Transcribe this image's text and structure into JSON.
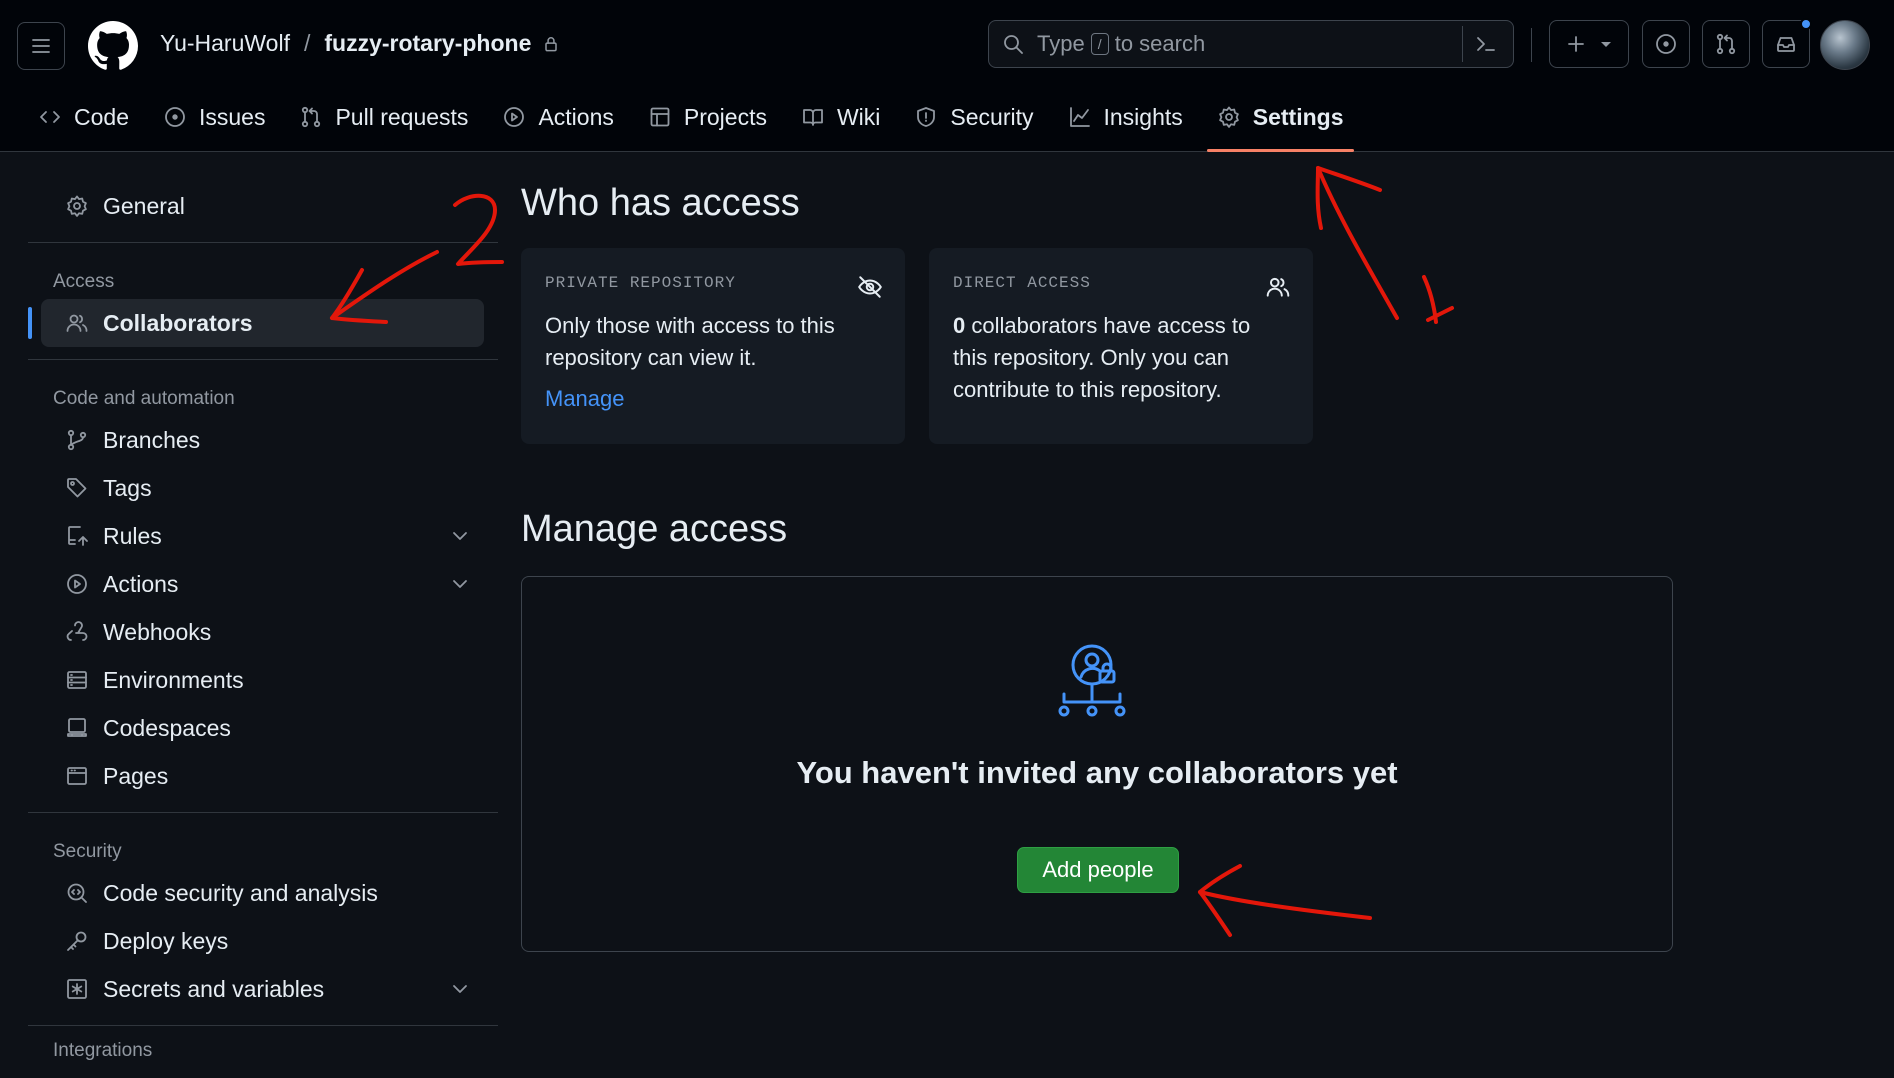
{
  "header": {
    "owner": "Yu-HaruWolf",
    "separator": "/",
    "repo": "fuzzy-rotary-phone",
    "search_prefix": "Type",
    "search_key": "/",
    "search_suffix": "to search"
  },
  "tabs": [
    {
      "label": "Code",
      "icon": "code-icon"
    },
    {
      "label": "Issues",
      "icon": "issue-opened-icon"
    },
    {
      "label": "Pull requests",
      "icon": "git-pull-request-icon"
    },
    {
      "label": "Actions",
      "icon": "play-icon"
    },
    {
      "label": "Projects",
      "icon": "table-icon"
    },
    {
      "label": "Wiki",
      "icon": "book-icon"
    },
    {
      "label": "Security",
      "icon": "shield-icon"
    },
    {
      "label": "Insights",
      "icon": "graph-icon"
    },
    {
      "label": "Settings",
      "icon": "gear-icon",
      "active": true
    }
  ],
  "sidebar": {
    "general": "General",
    "access_heading": "Access",
    "collaborators": "Collaborators",
    "code_heading": "Code and automation",
    "code_items": [
      "Branches",
      "Tags",
      "Rules",
      "Actions",
      "Webhooks",
      "Environments",
      "Codespaces",
      "Pages"
    ],
    "security_heading": "Security",
    "security_items": [
      "Code security and analysis",
      "Deploy keys",
      "Secrets and variables"
    ],
    "integrations_heading": "Integrations"
  },
  "main": {
    "who_title": "Who has access",
    "private_card": {
      "label": "PRIVATE REPOSITORY",
      "body": "Only those with access to this repository can view it.",
      "link": "Manage"
    },
    "direct_card": {
      "label": "DIRECT ACCESS",
      "count": "0",
      "body": " collaborators have access to this repository. Only you can contribute to this repository."
    },
    "manage_title": "Manage access",
    "empty_title": "You haven't invited any collaborators yet",
    "add_button": "Add people"
  },
  "annotations": {
    "label_1": "1",
    "label_2": "2"
  },
  "colors": {
    "background": "#0d1117",
    "header": "#010409",
    "accent_tab": "#f78166",
    "link": "#4493f8",
    "primary_button": "#238636",
    "annotation": "#e3170a"
  }
}
